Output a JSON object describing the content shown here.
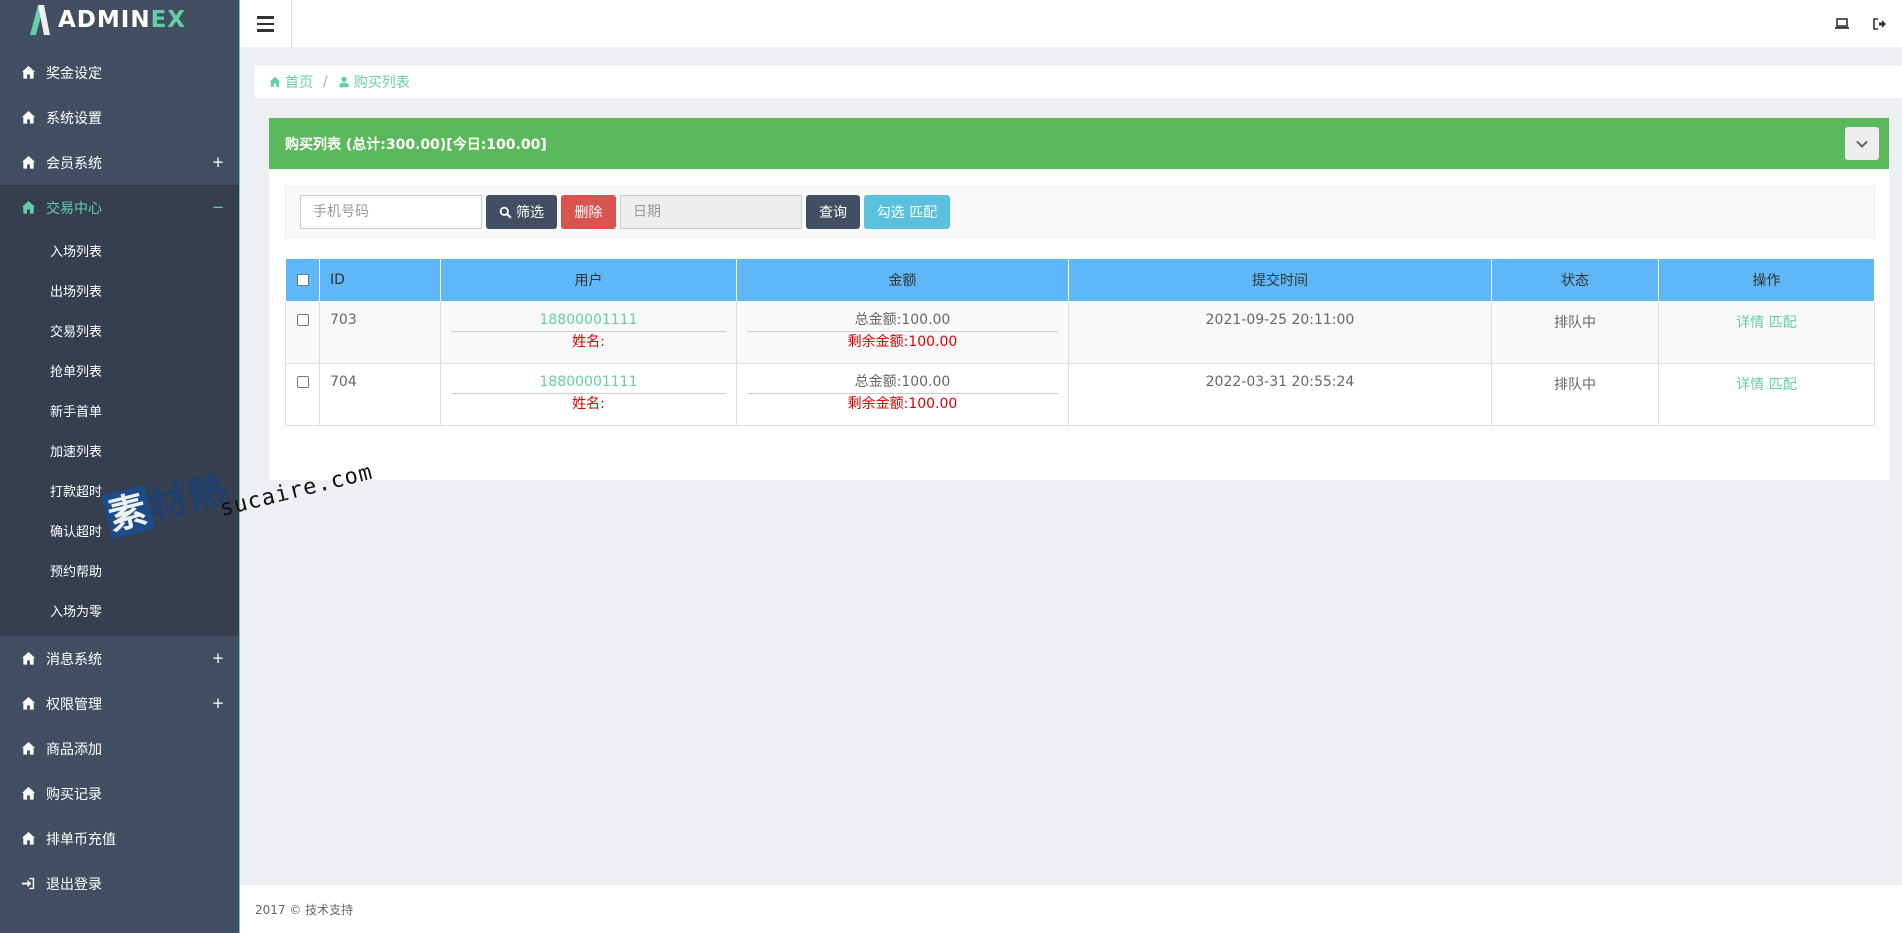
{
  "app": {
    "logo_main": "ADMIN",
    "logo_accent": "EX"
  },
  "sidebar": {
    "items": [
      {
        "label": "奖金设定",
        "expand": ""
      },
      {
        "label": "系统设置",
        "expand": ""
      },
      {
        "label": "会员系统",
        "expand": "+"
      },
      {
        "label": "交易中心",
        "expand": "−"
      }
    ],
    "subitems": [
      "入场列表",
      "出场列表",
      "交易列表",
      "抢单列表",
      "新手首单",
      "加速列表",
      "打款超时",
      "确认超时",
      "预约帮助",
      "入场为零"
    ],
    "items_after": [
      {
        "label": "消息系统",
        "expand": "+"
      },
      {
        "label": "权限管理",
        "expand": "+"
      },
      {
        "label": "商品添加",
        "expand": ""
      },
      {
        "label": "购买记录",
        "expand": ""
      },
      {
        "label": "排单币充值",
        "expand": ""
      },
      {
        "label": "退出登录",
        "expand": ""
      }
    ]
  },
  "breadcrumb": {
    "home": "首页",
    "sep": "/",
    "current": "购买列表"
  },
  "panel": {
    "title": "购买列表 (总计:300.00)[今日:100.00]"
  },
  "filter": {
    "phone_placeholder": "手机号码",
    "filter_label": "筛选",
    "delete_label": "删除",
    "date_placeholder": "日期",
    "query_label": "查询",
    "match_label": "勾选 匹配"
  },
  "table": {
    "headers": {
      "id": "ID",
      "user": "用户",
      "amount": "金额",
      "time": "提交时间",
      "status": "状态",
      "ops": "操作"
    },
    "rows": [
      {
        "id": "703",
        "phone": "18800001111",
        "name": "姓名:",
        "total": "总金额:100.00",
        "remain": "剩余金额:100.00",
        "time": "2021-09-25 20:11:00",
        "status": "排队中",
        "detail": "详情",
        "match": "匹配"
      },
      {
        "id": "704",
        "phone": "18800001111",
        "name": "姓名:",
        "total": "总金额:100.00",
        "remain": "剩余金额:100.00",
        "time": "2022-03-31 20:55:24",
        "status": "排队中",
        "detail": "详情",
        "match": "匹配"
      }
    ]
  },
  "footer": {
    "text": "2017 © 技术支持"
  },
  "watermark": {
    "cn_first": "素",
    "cn_rest": "材熱",
    "en": "sucaire.com"
  },
  "icons": {
    "nav": "home-icon",
    "logout": "sign-in-icon",
    "laptop": "laptop-icon",
    "signout": "sign-out-icon",
    "search": "search-icon",
    "collapse": "chevron-down-icon",
    "user": "user-icon"
  },
  "colors": {
    "sidebar": "#424f63",
    "accent": "#65cea7",
    "panel_head": "#5cb85c",
    "table_head": "#5eb8f7",
    "danger": "#d9534f",
    "info": "#5bc0de",
    "warning": "#f0ad4e"
  }
}
